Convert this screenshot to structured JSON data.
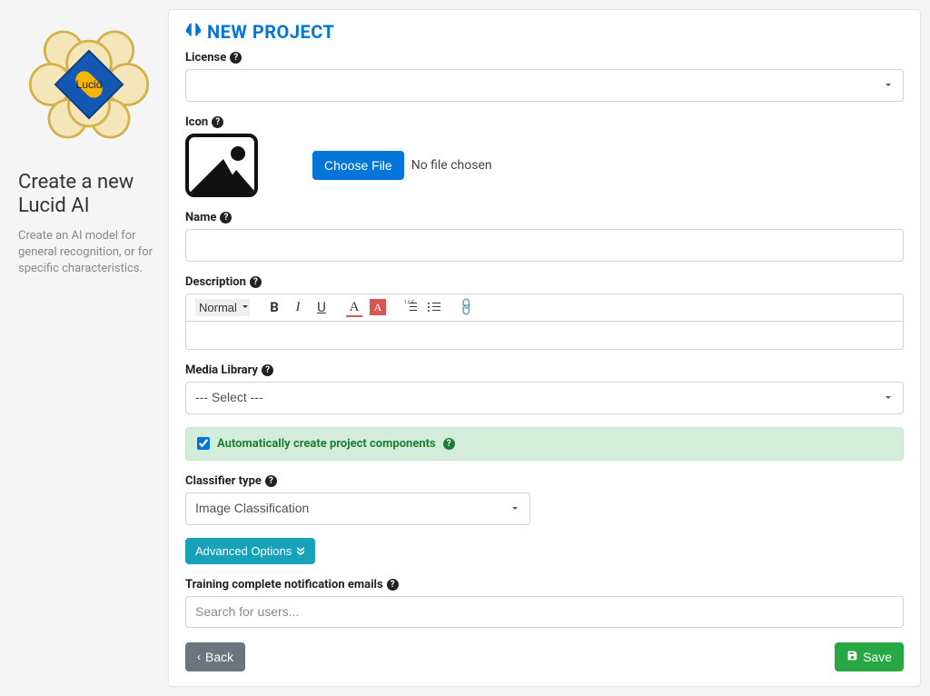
{
  "sidebar": {
    "title": "Create a new Lucid AI",
    "subtitle": "Create an AI model for general recognition, or for specific characteristics."
  },
  "page": {
    "title": "NEW PROJECT"
  },
  "form": {
    "license_label": "License",
    "license_value": "",
    "icon_label": "Icon",
    "choose_file": "Choose File",
    "no_file": "No file chosen",
    "name_label": "Name",
    "name_value": "",
    "description_label": "Description",
    "editor_format": "Normal",
    "media_label": "Media Library",
    "media_selected": "--- Select ---",
    "auto_components_label": "Automatically create project components",
    "auto_components_checked": true,
    "classifier_label": "Classifier type",
    "classifier_selected": "Image Classification",
    "advanced_label": "Advanced Options",
    "emails_label": "Training complete notification emails",
    "emails_placeholder": "Search for users..."
  },
  "buttons": {
    "back": "Back",
    "save": "Save"
  }
}
